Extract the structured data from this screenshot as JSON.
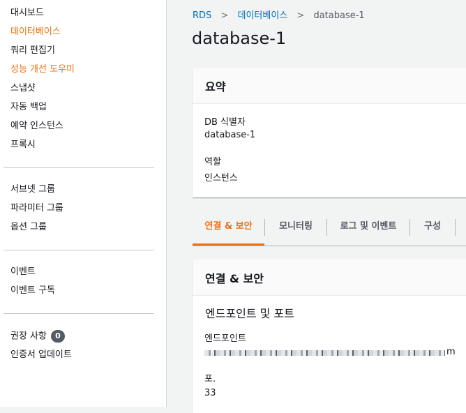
{
  "sidebar": {
    "group1": [
      {
        "label": "대시보드",
        "active": false
      },
      {
        "label": "데이터베이스",
        "active": true
      },
      {
        "label": "쿼리 편집기",
        "active": false
      },
      {
        "label": "성능 개선 도우미",
        "active": true
      },
      {
        "label": "스냅샷",
        "active": false
      },
      {
        "label": "자동 백업",
        "active": false
      },
      {
        "label": "예약 인스턴스",
        "active": false
      },
      {
        "label": "프록시",
        "active": false
      }
    ],
    "group2": [
      {
        "label": "서브넷 그룹"
      },
      {
        "label": "파라미터 그룹"
      },
      {
        "label": "옵션 그룹"
      }
    ],
    "group3": [
      {
        "label": "이벤트"
      },
      {
        "label": "이벤트 구독"
      }
    ],
    "group4": {
      "recommendations": {
        "label": "권장 사항",
        "count": "0"
      },
      "certificate_update": {
        "label": "인증서 업데이트"
      }
    }
  },
  "breadcrumb": {
    "items": [
      "RDS",
      "데이터베이스"
    ],
    "separator": ">",
    "current": "database-1"
  },
  "page": {
    "title": "database-1"
  },
  "summary": {
    "title": "요약",
    "db_id_label": "DB 식별자",
    "db_id_value": "database-1",
    "role_label": "역할",
    "role_value": "인스턴스"
  },
  "tabs": [
    {
      "label": "연결 & 보안",
      "active": true
    },
    {
      "label": "모니터링",
      "active": false
    },
    {
      "label": "로그 및 이벤트",
      "active": false
    },
    {
      "label": "구성",
      "active": false
    }
  ],
  "connectivity": {
    "title": "연결 & 보안",
    "section_title": "엔드포인트 및 포트",
    "endpoint_label": "엔드포인트",
    "endpoint_suffix": "m",
    "port_label": "포.",
    "port_value": "33"
  },
  "colors": {
    "accent": "#ec7211",
    "link": "#0073bb",
    "badge": "#545b64"
  }
}
